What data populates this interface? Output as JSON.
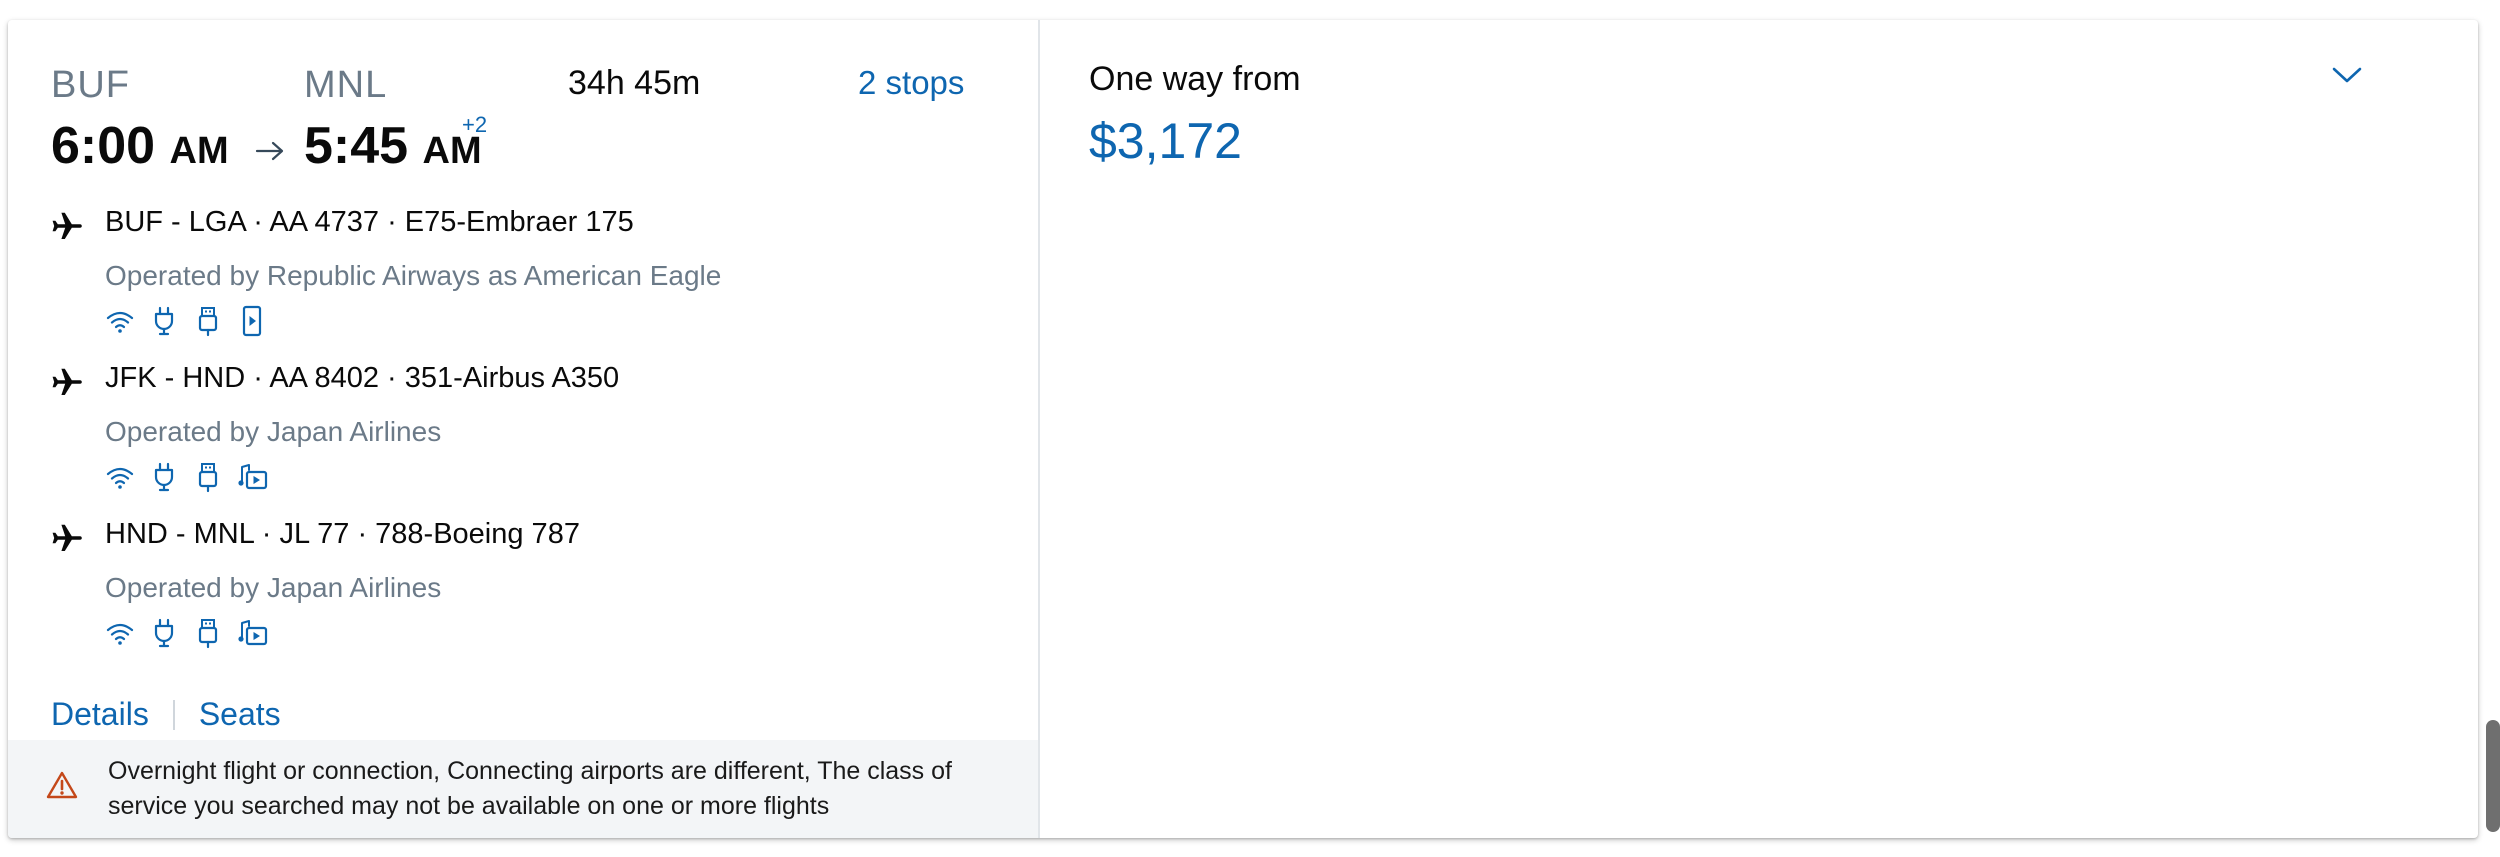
{
  "summary": {
    "origin": "BUF",
    "destination": "MNL",
    "duration": "34h 45m",
    "stops": "2 stops",
    "depart_time": "6:00",
    "depart_ampm": "AM",
    "arrive_time": "5:45",
    "arrive_ampm": "AM",
    "day_offset": "+2"
  },
  "segments": [
    {
      "route": "BUF - LGA · AA 4737 · E75-Embraer 175",
      "operator": "Operated by Republic Airways as American Eagle",
      "amenities": [
        "wifi-icon",
        "power-outlet-icon",
        "usb-icon",
        "seatback-entertainment-icon"
      ]
    },
    {
      "route": "JFK - HND · AA 8402 · 351-Airbus A350",
      "operator": "Operated by Japan Airlines",
      "amenities": [
        "wifi-icon",
        "power-outlet-icon",
        "usb-icon",
        "streaming-entertainment-icon"
      ]
    },
    {
      "route": "HND - MNL · JL 77 · 788-Boeing 787",
      "operator": "Operated by Japan Airlines",
      "amenities": [
        "wifi-icon",
        "power-outlet-icon",
        "usb-icon",
        "streaming-entertainment-icon"
      ]
    }
  ],
  "links": {
    "details": "Details",
    "seats": "Seats"
  },
  "alert": {
    "icon": "warning-icon",
    "text": "Overnight flight or connection, Connecting airports are different, The class of service you searched may not be available on one or more flights"
  },
  "fare": {
    "label": "One way from",
    "price": "$3,172",
    "expand_icon": "chevron-down-icon"
  },
  "colors": {
    "link_blue": "#0e66b0",
    "text_dark": "#0a0a0a",
    "text_muted": "#6b7a88",
    "warning_orange": "#c4481a",
    "alert_bg": "#f3f5f7"
  }
}
